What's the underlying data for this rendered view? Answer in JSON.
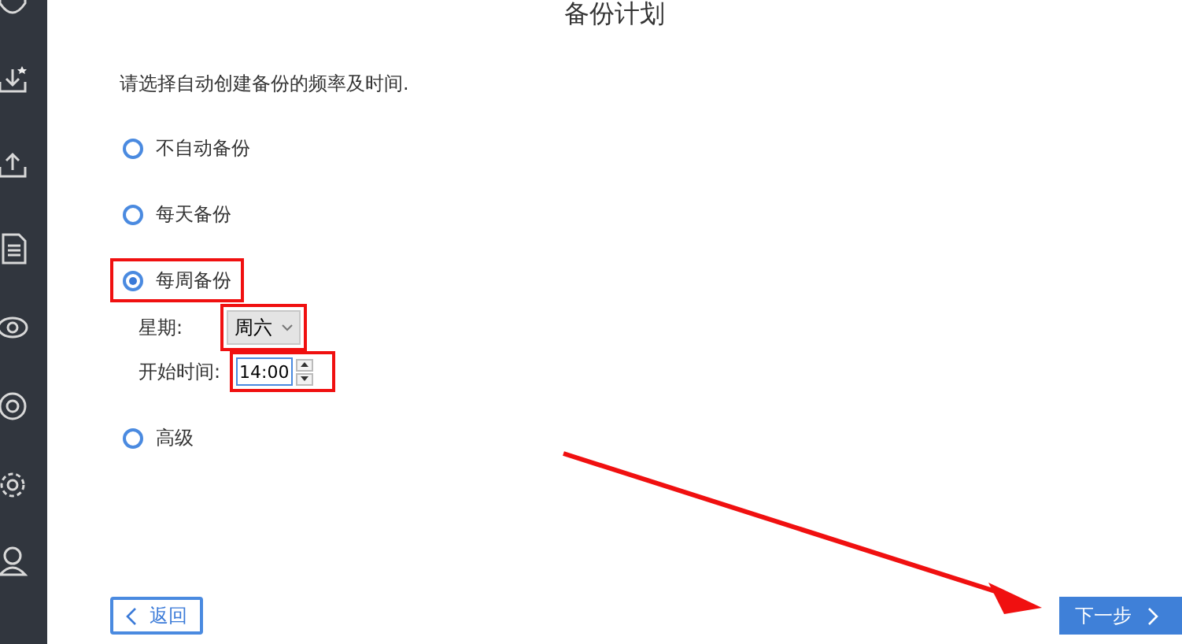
{
  "title": "备份计划",
  "instruction": "请选择自动创建备份的频率及时间.",
  "options": [
    {
      "label": "不自动备份",
      "selected": false
    },
    {
      "label": "每天备份",
      "selected": false
    },
    {
      "label": "每周备份",
      "selected": true
    },
    {
      "label": "高级",
      "selected": false
    }
  ],
  "weekly": {
    "day_label": "星期:",
    "day_value": "周六",
    "time_label": "开始时间:",
    "time_value": "14:00"
  },
  "buttons": {
    "back": "返回",
    "next": "下一步"
  }
}
